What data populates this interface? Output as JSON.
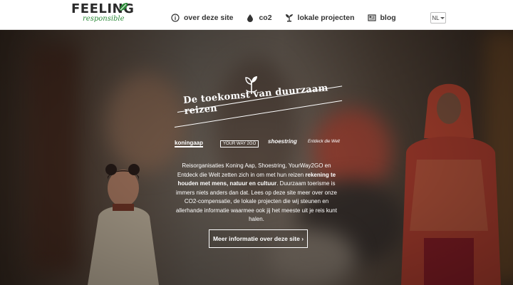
{
  "brand": {
    "logo_word": "FEELING",
    "logo_sub": "responsible",
    "accent": "#2e8b3a"
  },
  "nav": {
    "items": [
      {
        "label": "over deze site",
        "icon": "info-icon"
      },
      {
        "label": "co2",
        "icon": "drop-icon"
      },
      {
        "label": "lokale projecten",
        "icon": "seedling-icon"
      },
      {
        "label": "blog",
        "icon": "newspaper-icon"
      }
    ],
    "language": "NL"
  },
  "hero": {
    "title": "De toekomst van duurzaam reizen",
    "partners": [
      "koningaap",
      "YOUR WAY 2GO",
      "shoestring",
      "Entdeck die Welt"
    ],
    "description_intro": "Reisorganisaties Koning Aap, Shoestring, YourWay2GO en Entdeck die Welt zetten zich in om met hun reizen ",
    "description_bold": "rekening te houden met mens, natuur en cultuur",
    "description_rest": ". Duurzaam toerisme is immers niets anders dan dat. Lees op deze site meer over onze CO2-compensatie, de lokale projecten die wij steunen en allerhande informatie waarmee ook jij het meeste uit je reis kunt halen.",
    "cta_label": "Meer informatie over deze site ›"
  }
}
